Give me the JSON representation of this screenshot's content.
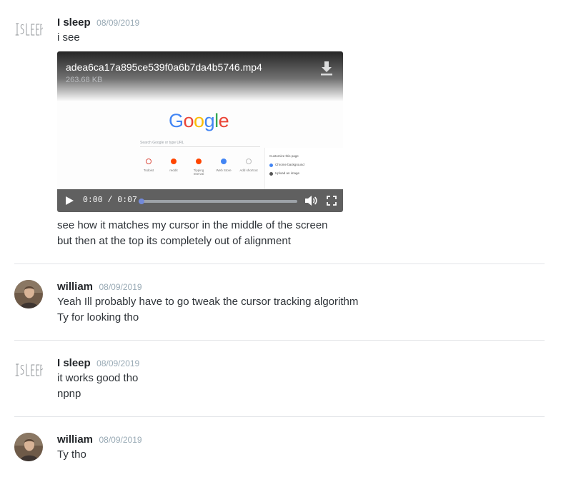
{
  "messages": [
    {
      "username": "I sleep",
      "timestamp": "08/09/2019",
      "lines": [
        "i see"
      ],
      "attachment": {
        "filename": "adea6ca17a895ce539f0a6b7da4b5746.mp4",
        "size": "263.68 KB",
        "time": "0:00 / 0:07",
        "progress_fraction": 0.02,
        "preview": {
          "logo_text": "Google",
          "search_placeholder": "Search Google or type URL",
          "tiles": [
            "Todoist",
            "reddit",
            "Tipping Interval",
            "Web Store",
            "Add shortcut"
          ],
          "panel_title": "Customize this page",
          "panel_rows": [
            "Chrome background",
            "Upload an image"
          ]
        }
      },
      "after_lines": [
        "see how it matches my cursor in the middle of the screen",
        "but then at the top its completely out of alignment"
      ]
    },
    {
      "username": "william",
      "timestamp": "08/09/2019",
      "lines": [
        "Yeah Ill probably have to go tweak the cursor tracking algorithm",
        "Ty for looking tho"
      ]
    },
    {
      "username": "I sleep",
      "timestamp": "08/09/2019",
      "lines": [
        "it works good tho",
        "npnp"
      ]
    },
    {
      "username": "william",
      "timestamp": "08/09/2019",
      "lines": [
        "Ty tho"
      ]
    }
  ],
  "avatars": {
    "isleep_text": "ISLEEP"
  },
  "colors": {
    "username": "#23262a",
    "timestamp": "#99aab5",
    "text": "#2e3338",
    "divider": "#e3e5e8",
    "progress": "#7289da"
  },
  "icons": [
    "play-icon",
    "volume-icon",
    "fullscreen-icon",
    "download-icon"
  ]
}
